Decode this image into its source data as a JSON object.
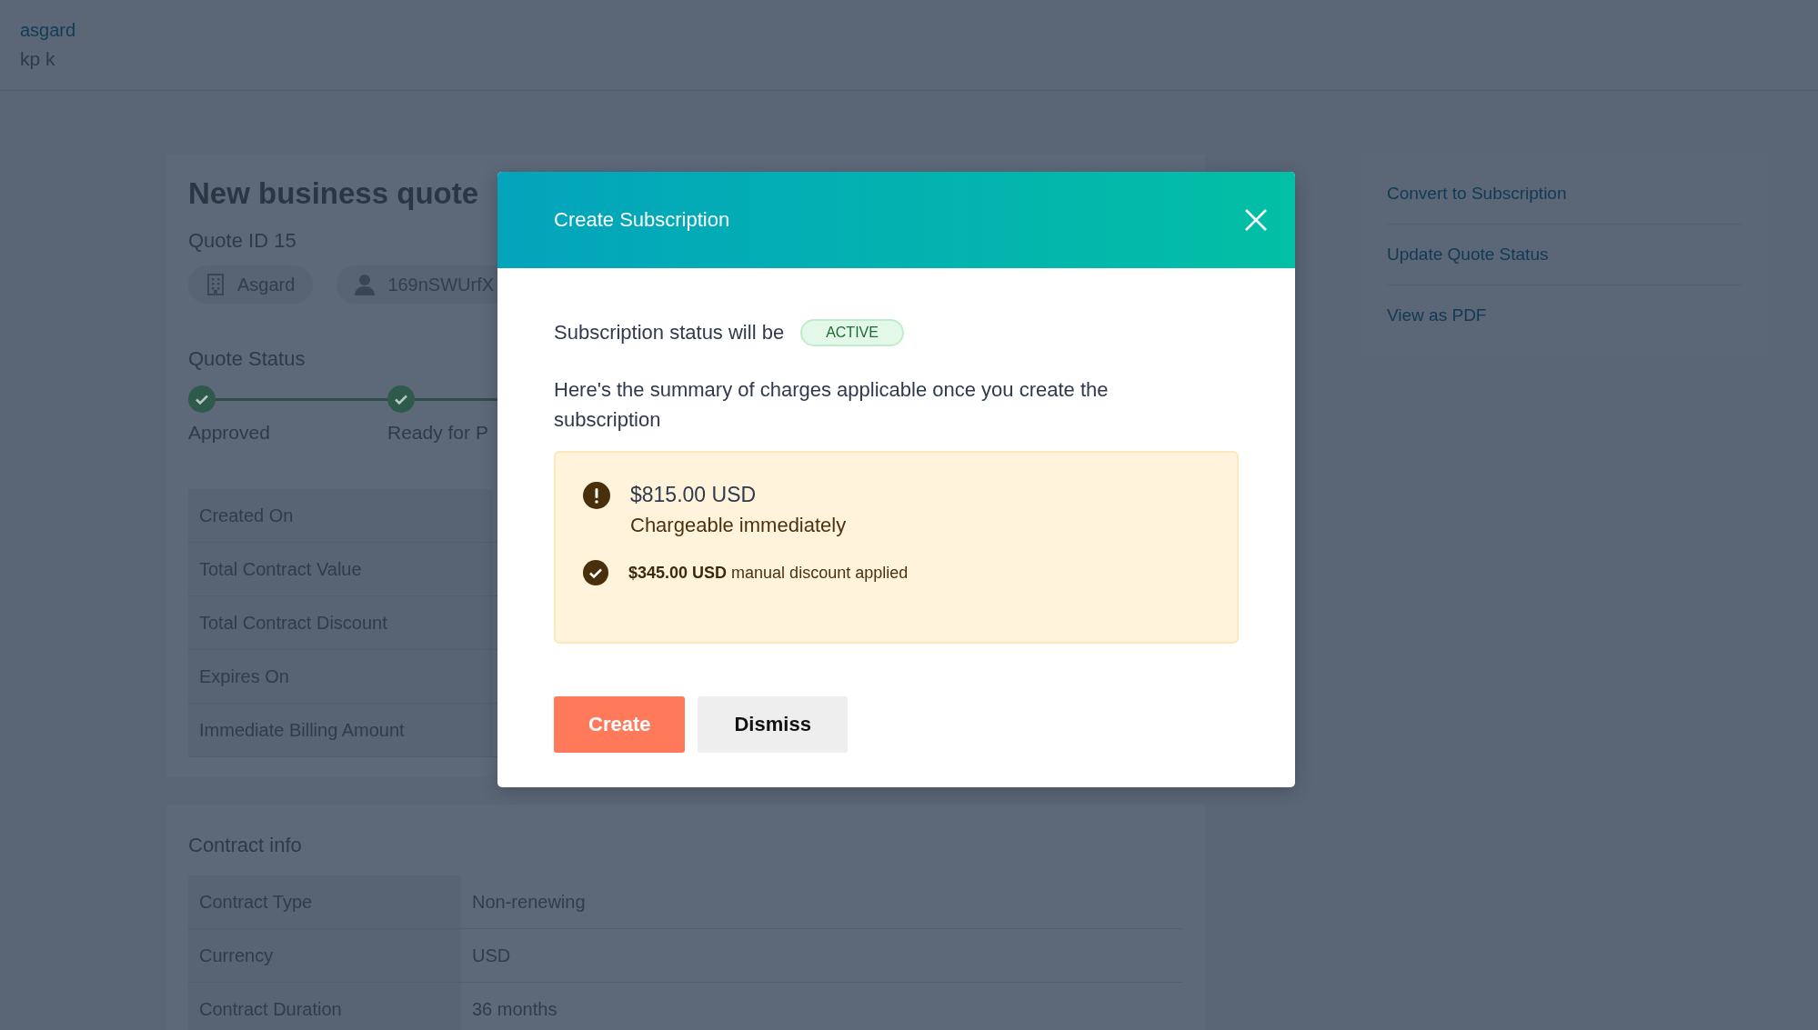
{
  "header": {
    "org": "asgard",
    "user": "kp k"
  },
  "quote": {
    "title": "New business quote",
    "quote_id": "Quote ID 15",
    "chips": [
      {
        "kind": "company",
        "label": "Asgard"
      },
      {
        "kind": "person",
        "label": "169nSWUrfX"
      }
    ],
    "status_title": "Quote Status",
    "steps": [
      {
        "label": "Approved",
        "done": true
      },
      {
        "label": "Ready for P",
        "done": true
      }
    ],
    "details": [
      "Created On",
      "Total Contract Value",
      "Total Contract Discount",
      "Expires On",
      "Immediate Billing Amount"
    ]
  },
  "contract_info": {
    "title": "Contract info",
    "rows": [
      {
        "label": "Contract Type",
        "value": "Non-renewing"
      },
      {
        "label": "Currency",
        "value": "USD"
      },
      {
        "label": "Contract Duration",
        "value": "36 months"
      }
    ]
  },
  "actions": [
    "Convert to Subscription",
    "Update Quote Status",
    "View as PDF"
  ],
  "modal": {
    "title": "Create Subscription",
    "status_text": "Subscription status will be",
    "status_badge": "ACTIVE",
    "summary": "Here's the summary of charges applicable once you create the subscription",
    "amount": "$815.00 USD",
    "amount_note": "Chargeable immediately",
    "discount": "**$345.00 USD** manual discount applied",
    "buttons": [
      {
        "label": "Create",
        "kind": "primary"
      },
      {
        "label": "Dismiss",
        "kind": "secondary"
      }
    ]
  }
}
